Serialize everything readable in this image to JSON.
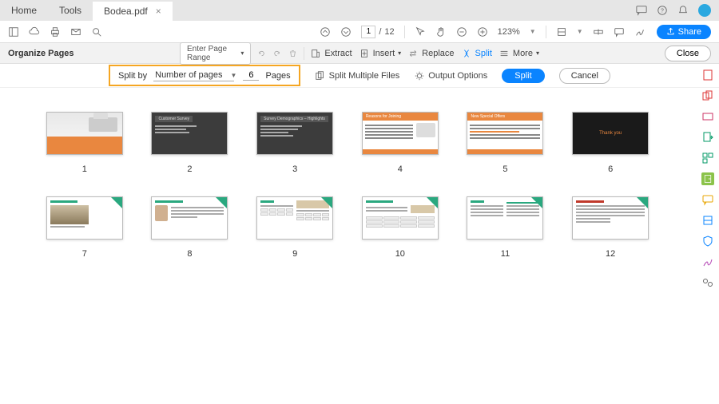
{
  "tabs": {
    "home": "Home",
    "tools": "Tools",
    "file": "Bodea.pdf"
  },
  "toolbar": {
    "page_current": "1",
    "page_sep": "/",
    "page_total": "12",
    "zoom": "123%",
    "share": "Share"
  },
  "subbar": {
    "title": "Organize Pages",
    "page_range": "Enter Page Range",
    "extract": "Extract",
    "insert": "Insert",
    "replace": "Replace",
    "split": "Split",
    "more": "More",
    "close": "Close"
  },
  "splitbar": {
    "split_by": "Split by",
    "method": "Number of pages",
    "count": "6",
    "pages": "Pages",
    "multi": "Split Multiple Files",
    "output": "Output Options",
    "split_btn": "Split",
    "cancel_btn": "Cancel"
  },
  "pages": {
    "p1": "1",
    "p2": "2",
    "p3": "3",
    "p4": "4",
    "p5": "5",
    "p6": "6",
    "p7": "7",
    "p8": "8",
    "p9": "9",
    "p10": "10",
    "p11": "11",
    "p12": "12"
  },
  "thumbs": {
    "t2_title": "Customer Survey",
    "t3_title": "Survey Demographics – Highlights",
    "t4_title": "Reasons for Joining",
    "t5_title": "New Special Offers",
    "t6_text": "Thank you"
  }
}
